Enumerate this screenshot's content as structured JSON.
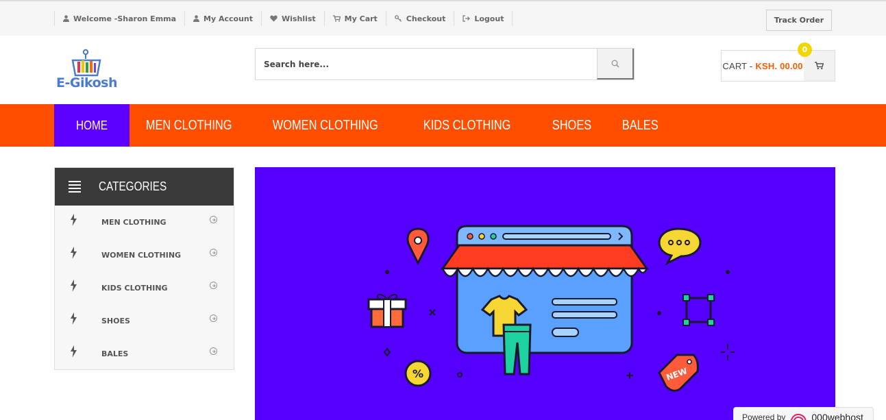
{
  "topbar": {
    "links": [
      {
        "label": "Welcome -Sharon Emma",
        "icon": "user-icon"
      },
      {
        "label": "My Account",
        "icon": "user-icon"
      },
      {
        "label": "Wishlist",
        "icon": "heart-icon"
      },
      {
        "label": "My Cart",
        "icon": "cart-icon"
      },
      {
        "label": "Checkout",
        "icon": "key-icon"
      },
      {
        "label": "Logout",
        "icon": "logout-icon"
      }
    ],
    "track_order": "Track Order"
  },
  "header": {
    "logo_text": "E-Gikosh",
    "search_placeholder": "Search here...",
    "cart_label": "CART -",
    "cart_amount": "KSH. 00.00",
    "cart_count": "0"
  },
  "nav": {
    "items": [
      "HOME",
      "MEN CLOTHING",
      "WOMEN CLOTHING",
      "KIDS CLOTHING",
      "SHOES",
      "BALES"
    ],
    "active_index": 0
  },
  "categories": {
    "title": "CATEGORIES",
    "items": [
      "MEN CLOTHING",
      "WOMEN CLOTHING",
      "KIDS CLOTHING",
      "SHOES",
      "BALES"
    ]
  },
  "banner": {
    "tag_text": "NEW",
    "percent_text": "%"
  },
  "footer_badge": {
    "powered_by": "Powered by",
    "brand": "000webhost"
  },
  "colors": {
    "accent_orange": "#ff4e00",
    "accent_purple": "#5c00ff",
    "badge_yellow": "#f1d600"
  }
}
